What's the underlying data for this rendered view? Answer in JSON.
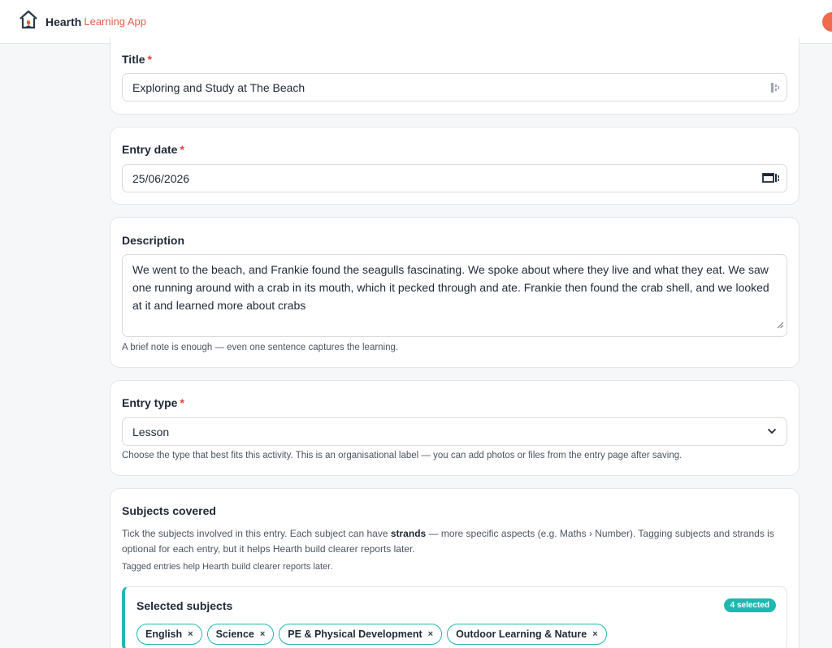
{
  "app": {
    "name": "Hearth",
    "subtitle": "Learning App"
  },
  "title_section": {
    "label": "Title",
    "required": "*",
    "value": "Exploring and Study at The Beach"
  },
  "date_section": {
    "label": "Entry date",
    "required": "*",
    "value": "25/06/2026"
  },
  "description_section": {
    "label": "Description",
    "value": "We went to the beach, and Frankie found the seagulls fascinating. We spoke about where they live and what they eat. We saw one running around with a crab in its mouth, which it pecked through and ate. Frankie then found the crab shell, and we looked at it and learned more about crabs",
    "hint": "A brief note is enough — even one sentence captures the learning."
  },
  "type_section": {
    "label": "Entry type",
    "required": "*",
    "value": "Lesson",
    "hint": "Choose the type that best fits this activity. This is an organisational label — you can add photos or files from the entry page after saving."
  },
  "subjects_section": {
    "label": "Subjects covered",
    "desc_before": "Tick the subjects involved in this entry. Each subject can have ",
    "desc_bold": "strands",
    "desc_after": " — more specific aspects (e.g. Maths › Number). Tagging subjects and strands is optional for each entry, but it helps Hearth build clearer reports later.",
    "note": "Tagged entries help Hearth build clearer reports later.",
    "selected_title": "Selected subjects",
    "selected_count": "4 selected",
    "chips": [
      {
        "label": "English",
        "remove": "×"
      },
      {
        "label": "Science",
        "remove": "×"
      },
      {
        "label": "PE & Physical Development",
        "remove": "×"
      },
      {
        "label": "Outdoor Learning & Nature",
        "remove": "×"
      }
    ]
  },
  "colors": {
    "accent": "#1fb8b0",
    "brand": "#e25c49",
    "required": "#e0453a"
  },
  "icons": [
    "house-logo-icon",
    "password-manager-icon",
    "calendar-icon",
    "chevron-down-icon",
    "resize-handle-icon",
    "close-icon"
  ]
}
